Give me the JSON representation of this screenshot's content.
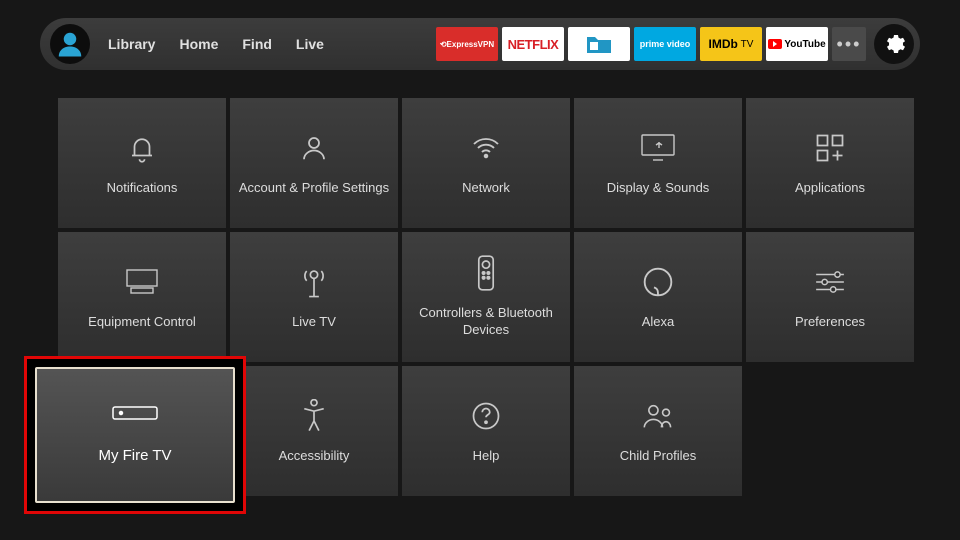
{
  "topbar": {
    "nav": [
      "Library",
      "Home",
      "Find",
      "Live"
    ],
    "apps": [
      {
        "id": "expressvpn",
        "label": "ExpressVPN"
      },
      {
        "id": "netflix",
        "label": "NETFLIX"
      },
      {
        "id": "es",
        "label": "ES"
      },
      {
        "id": "prime",
        "label": "prime video"
      },
      {
        "id": "imdb",
        "label": "IMDb TV"
      },
      {
        "id": "youtube",
        "label": "YouTube"
      }
    ],
    "more": "•••"
  },
  "tiles": {
    "notifications": "Notifications",
    "account": "Account & Profile Settings",
    "network": "Network",
    "display": "Display & Sounds",
    "applications": "Applications",
    "equipment": "Equipment Control",
    "livetv": "Live TV",
    "controllers": "Controllers & Bluetooth Devices",
    "alexa": "Alexa",
    "preferences": "Preferences",
    "myfiretv": "My Fire TV",
    "accessibility": "Accessibility",
    "help": "Help",
    "childprofiles": "Child Profiles"
  }
}
